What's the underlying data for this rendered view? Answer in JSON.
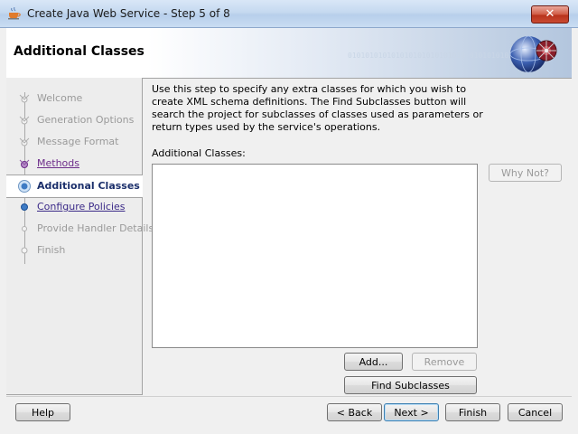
{
  "window": {
    "title": "Create Java Web Service - Step 5 of 8",
    "close_label": "✕"
  },
  "banner": {
    "title": "Additional Classes",
    "binary_text": "010101010101010101010101010 01010101010"
  },
  "nav": {
    "items": [
      {
        "label": "Welcome",
        "state": "disabled"
      },
      {
        "label": "Generation Options",
        "state": "disabled"
      },
      {
        "label": "Message Format",
        "state": "disabled"
      },
      {
        "label": "Methods",
        "state": "visited"
      },
      {
        "label": "Additional Classes",
        "state": "current"
      },
      {
        "label": "Configure Policies",
        "state": "link"
      },
      {
        "label": "Provide Handler Details",
        "state": "disabled"
      },
      {
        "label": "Finish",
        "state": "disabled"
      }
    ]
  },
  "content": {
    "description": "Use this step to specify any extra classes for which you wish to create XML schema definitions. The Find Subclasses button will search the project for subclasses of classes used as parameters or return types used by the service's operations.",
    "additional_classes_label": "Additional Classes:",
    "why_not_label": "Why Not?",
    "add_label": "Add...",
    "remove_label": "Remove",
    "find_subclasses_label": "Find Subclasses"
  },
  "footer": {
    "help_label": "Help",
    "back_label": "< Back",
    "next_label": "Next >",
    "finish_label": "Finish",
    "cancel_label": "Cancel"
  },
  "colors": {
    "current_step": "#1b2f6b",
    "link": "#3b2a88",
    "visited": "#6d2d8a",
    "disabled_text": "#9a9a9a"
  }
}
